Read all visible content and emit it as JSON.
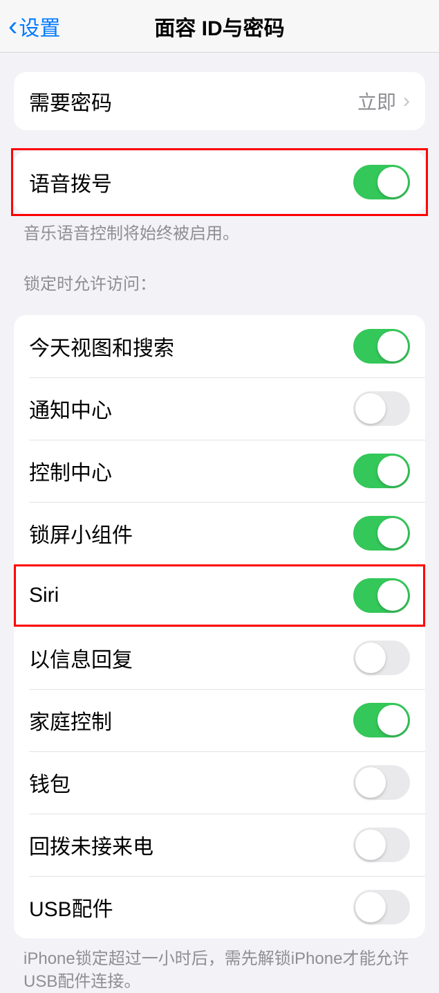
{
  "nav": {
    "back_label": "设置",
    "title": "面容 ID与密码"
  },
  "group1": {
    "require_passcode_label": "需要密码",
    "require_passcode_value": "立即"
  },
  "group2": {
    "voice_dial_label": "语音拨号",
    "voice_dial_on": true,
    "footer": "音乐语音控制将始终被启用。"
  },
  "section_header": "锁定时允许访问：",
  "lock_items": [
    {
      "label": "今天视图和搜索",
      "on": true
    },
    {
      "label": "通知中心",
      "on": false
    },
    {
      "label": "控制中心",
      "on": true
    },
    {
      "label": "锁屏小组件",
      "on": true
    },
    {
      "label": "Siri",
      "on": true
    },
    {
      "label": "以信息回复",
      "on": false
    },
    {
      "label": "家庭控制",
      "on": true
    },
    {
      "label": "钱包",
      "on": false
    },
    {
      "label": "回拨未接来电",
      "on": false
    },
    {
      "label": "USB配件",
      "on": false
    }
  ],
  "bottom_footer": "iPhone锁定超过一小时后，需先解锁iPhone才能允许USB配件连接。"
}
